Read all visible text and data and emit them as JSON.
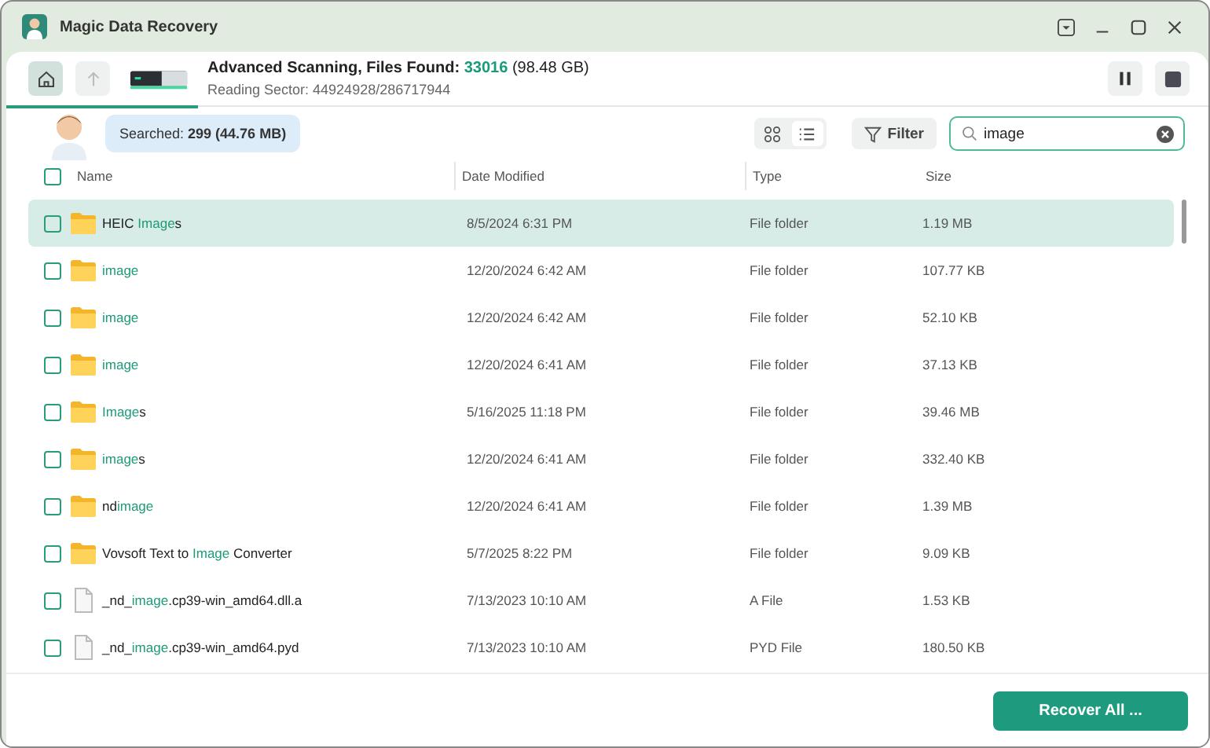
{
  "window": {
    "title": "Magic Data Recovery"
  },
  "scan": {
    "title": "Advanced Scanning, Files Found: ",
    "found": "33016",
    "size": " (98.48 GB)",
    "sector": "Reading Sector: 44924928/286717944",
    "level": 0.16
  },
  "searched": {
    "label": "Searched: ",
    "value": "299 (44.76 MB)"
  },
  "view": {
    "grid_selected": false,
    "list_selected": true
  },
  "filter": {
    "label": "Filter"
  },
  "search": {
    "value": "image"
  },
  "table": {
    "select_all": false,
    "columns": [
      "Name",
      "Date Modified",
      "Type",
      "Size"
    ],
    "rows": [
      {
        "kind": "folder",
        "checked": false,
        "selected": true,
        "name": [
          {
            "text": "HEIC ",
            "match": false
          },
          {
            "text": "Image",
            "match": true
          },
          {
            "text": "s",
            "match": false
          }
        ],
        "date": "8/5/2024 6:31 PM",
        "type": "File folder",
        "size": "1.19 MB"
      },
      {
        "kind": "folder",
        "checked": false,
        "selected": false,
        "name": [
          {
            "text": "image",
            "match": true
          }
        ],
        "date": "12/20/2024 6:42 AM",
        "type": "File folder",
        "size": "107.77 KB"
      },
      {
        "kind": "folder",
        "checked": false,
        "selected": false,
        "name": [
          {
            "text": "image",
            "match": true
          }
        ],
        "date": "12/20/2024 6:42 AM",
        "type": "File folder",
        "size": "52.10 KB"
      },
      {
        "kind": "folder",
        "checked": false,
        "selected": false,
        "name": [
          {
            "text": "image",
            "match": true
          }
        ],
        "date": "12/20/2024 6:41 AM",
        "type": "File folder",
        "size": "37.13 KB"
      },
      {
        "kind": "folder",
        "checked": false,
        "selected": false,
        "name": [
          {
            "text": "Image",
            "match": true
          },
          {
            "text": "s",
            "match": false
          }
        ],
        "date": "5/16/2025 11:18 PM",
        "type": "File folder",
        "size": "39.46 MB"
      },
      {
        "kind": "folder",
        "checked": false,
        "selected": false,
        "name": [
          {
            "text": "image",
            "match": true
          },
          {
            "text": "s",
            "match": false
          }
        ],
        "date": "12/20/2024 6:41 AM",
        "type": "File folder",
        "size": "332.40 KB"
      },
      {
        "kind": "folder",
        "checked": false,
        "selected": false,
        "name": [
          {
            "text": "nd",
            "match": false
          },
          {
            "text": "image",
            "match": true
          }
        ],
        "date": "12/20/2024 6:41 AM",
        "type": "File folder",
        "size": "1.39 MB"
      },
      {
        "kind": "folder",
        "checked": false,
        "selected": false,
        "name": [
          {
            "text": "Vovsoft Text to ",
            "match": false
          },
          {
            "text": "Image",
            "match": true
          },
          {
            "text": " Converter",
            "match": false
          }
        ],
        "date": "5/7/2025 8:22 PM",
        "type": "File folder",
        "size": "9.09 KB"
      },
      {
        "kind": "file",
        "checked": false,
        "selected": false,
        "name": [
          {
            "text": "_nd_",
            "match": false
          },
          {
            "text": "image",
            "match": true
          },
          {
            "text": ".cp39-win_amd64.dll.a",
            "match": false
          }
        ],
        "date": "7/13/2023 10:10 AM",
        "type": "A File",
        "size": "1.53 KB"
      },
      {
        "kind": "file",
        "checked": false,
        "selected": false,
        "name": [
          {
            "text": "_nd_",
            "match": false
          },
          {
            "text": "image",
            "match": true
          },
          {
            "text": ".cp39-win_amd64.pyd",
            "match": false
          }
        ],
        "date": "7/13/2023 10:10 AM",
        "type": "PYD File",
        "size": "180.50 KB"
      }
    ]
  },
  "buttons": {
    "recover": "Recover All ..."
  }
}
